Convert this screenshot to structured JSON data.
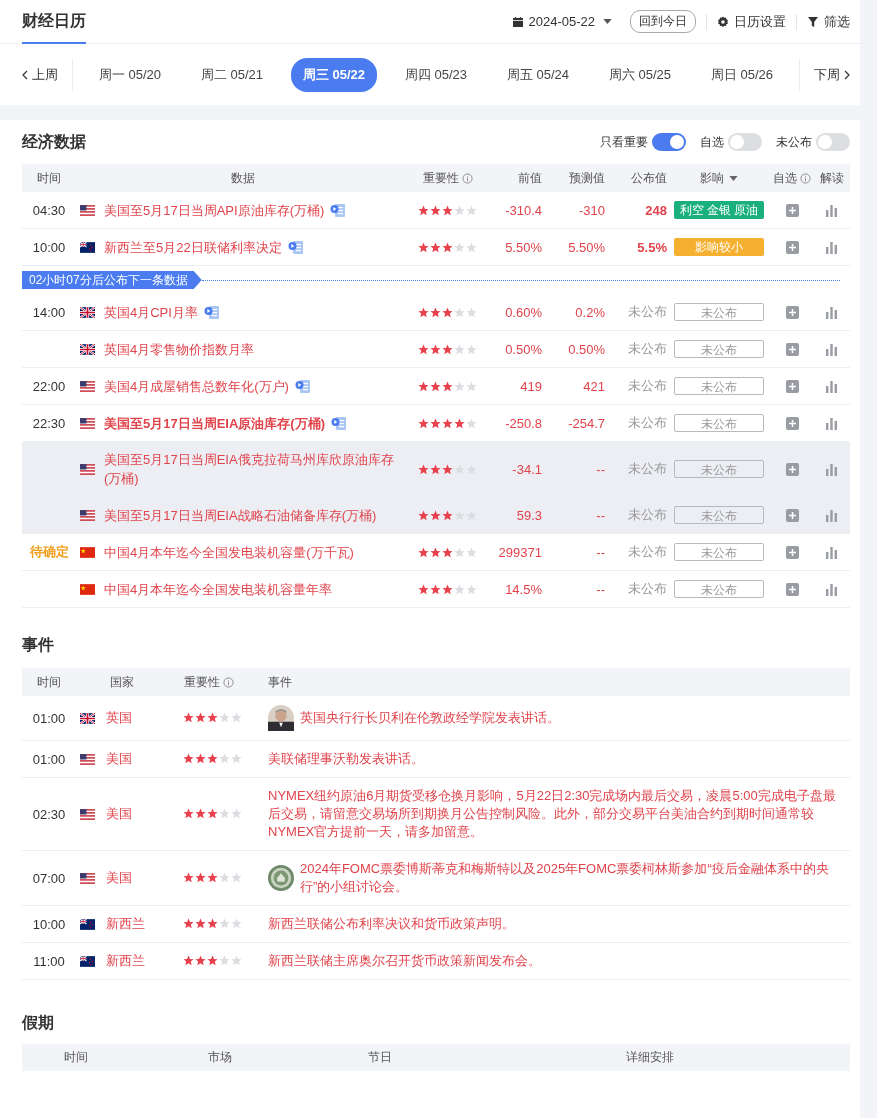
{
  "header": {
    "title": "财经日历",
    "date": "2024-05-22",
    "today_button": "回到今日",
    "settings": "日历设置",
    "filter": "筛选"
  },
  "week_nav": {
    "prev": "上周",
    "next": "下周",
    "days": [
      {
        "label": "周一 05/20",
        "selected": false
      },
      {
        "label": "周二 05/21",
        "selected": false
      },
      {
        "label": "周三 05/22",
        "selected": true
      },
      {
        "label": "周四 05/23",
        "selected": false
      },
      {
        "label": "周五 05/24",
        "selected": false
      },
      {
        "label": "周六 05/25",
        "selected": false
      },
      {
        "label": "周日 05/26",
        "selected": false
      }
    ]
  },
  "economic_data": {
    "title": "经济数据",
    "toggles": [
      {
        "label": "只看重要",
        "on": true
      },
      {
        "label": "自选",
        "on": false
      },
      {
        "label": "未公布",
        "on": false
      }
    ],
    "columns": [
      "时间",
      "数据",
      "重要性",
      "前值",
      "预测值",
      "公布值",
      "影响",
      "自选",
      "解读"
    ],
    "rows": [
      {
        "kind": "us",
        "time": "04:30",
        "tentative": false,
        "name": "美国至5月17日当周API原油库存(万桶)",
        "bold": false,
        "has_detail": true,
        "stars": 3,
        "previous": "-310.4",
        "forecast": "-310",
        "actual": "248",
        "released": true,
        "impact": {
          "kind": "bearish",
          "text": "利空 金银 原油"
        },
        "highlighted": false
      },
      {
        "kind": "nz",
        "time": "10:00",
        "tentative": false,
        "name": "新西兰至5月22日联储利率决定",
        "bold": false,
        "has_detail": true,
        "stars": 3,
        "previous": "5.50%",
        "forecast": "5.50%",
        "actual": "5.5%",
        "released": true,
        "impact": {
          "kind": "minor",
          "text": "影响较小"
        },
        "highlighted": false
      },
      {
        "kind": "countdown",
        "text": "02小时07分后公布下一条数据"
      },
      {
        "kind": "uk",
        "time": "14:00",
        "tentative": false,
        "name": "英国4月CPI月率",
        "bold": false,
        "has_detail": true,
        "stars": 3,
        "previous": "0.60%",
        "forecast": "0.2%",
        "actual": "未公布",
        "released": false,
        "impact": {
          "kind": "pending",
          "text": "未公布"
        },
        "highlighted": false
      },
      {
        "kind": "uk",
        "name": "英国4月零售物价指数月率",
        "bold": false,
        "has_detail": false,
        "stars": 3,
        "previous": "0.50%",
        "forecast": "0.50%",
        "actual": "未公布",
        "released": false,
        "impact": {
          "kind": "pending",
          "text": "未公布"
        },
        "highlighted": false
      },
      {
        "kind": "us",
        "time": "22:00",
        "tentative": false,
        "name": "美国4月成屋销售总数年化(万户)",
        "bold": false,
        "has_detail": true,
        "stars": 3,
        "previous": "419",
        "forecast": "421",
        "actual": "未公布",
        "released": false,
        "impact": {
          "kind": "pending",
          "text": "未公布"
        },
        "highlighted": false
      },
      {
        "kind": "us",
        "time": "22:30",
        "tentative": false,
        "name": "美国至5月17日当周EIA原油库存(万桶)",
        "bold": true,
        "has_detail": true,
        "stars": 4,
        "previous": "-250.8",
        "forecast": "-254.7",
        "actual": "未公布",
        "released": false,
        "impact": {
          "kind": "pending",
          "text": "未公布"
        },
        "highlighted": false
      },
      {
        "kind": "us",
        "name": "美国至5月17日当周EIA俄克拉荷马州库欣原油库存(万桶)",
        "bold": false,
        "has_detail": false,
        "stars": 3,
        "previous": "-34.1",
        "forecast": "--",
        "actual": "未公布",
        "released": false,
        "impact": {
          "kind": "pending",
          "text": "未公布"
        },
        "highlighted": true
      },
      {
        "kind": "us",
        "name": "美国至5月17日当周EIA战略石油储备库存(万桶)",
        "bold": false,
        "has_detail": false,
        "stars": 3,
        "previous": "59.3",
        "forecast": "--",
        "actual": "未公布",
        "released": false,
        "impact": {
          "kind": "pending",
          "text": "未公布"
        },
        "highlighted": true
      },
      {
        "kind": "cn",
        "time": "待确定",
        "tentative": true,
        "name": "中国4月本年迄今全国发电装机容量(万千瓦)",
        "bold": false,
        "has_detail": false,
        "stars": 3,
        "previous": "299371",
        "forecast": "--",
        "actual": "未公布",
        "released": false,
        "impact": {
          "kind": "pending",
          "text": "未公布"
        },
        "highlighted": false
      },
      {
        "kind": "cn",
        "name": "中国4月本年迄今全国发电装机容量年率",
        "bold": false,
        "has_detail": false,
        "stars": 3,
        "previous": "14.5%",
        "forecast": "--",
        "actual": "未公布",
        "released": false,
        "impact": {
          "kind": "pending",
          "text": "未公布"
        },
        "highlighted": false
      }
    ]
  },
  "events": {
    "title": "事件",
    "columns": [
      "时间",
      "国家",
      "重要性",
      "事件"
    ],
    "rows": [
      {
        "kind": "uk",
        "time": "01:00",
        "country": "英国",
        "stars": 3,
        "has_picture": true,
        "text": "英国央行行长贝利在伦敦政经学院发表讲话。"
      },
      {
        "kind": "us",
        "time": "01:00",
        "country": "美国",
        "stars": 3,
        "has_picture": false,
        "text": "美联储理事沃勒发表讲话。"
      },
      {
        "kind": "us",
        "time": "02:30",
        "country": "美国",
        "stars": 3,
        "has_picture": false,
        "text": "NYMEX纽约原油6月期货受移仓换月影响，5月22日2:30完成场内最后交易，凌晨5:00完成电子盘最后交易，请留意交易场所到期换月公告控制风险。此外，部分交易平台美油合约到期时间通常较NYMEX官方提前一天，请多加留意。"
      },
      {
        "kind": "us",
        "time": "07:00",
        "country": "美国",
        "stars": 3,
        "has_picture": true,
        "text": "2024年FOMC票委博斯蒂克和梅斯特以及2025年FOMC票委柯林斯参加“疫后金融体系中的央行”的小组讨论会。"
      },
      {
        "kind": "nz",
        "time": "10:00",
        "country": "新西兰",
        "stars": 3,
        "has_picture": false,
        "text": "新西兰联储公布利率决议和货币政策声明。"
      },
      {
        "kind": "nz",
        "time": "11:00",
        "country": "新西兰",
        "stars": 3,
        "has_picture": false,
        "text": "新西兰联储主席奥尔召开货币政策新闻发布会。"
      }
    ]
  },
  "holidays": {
    "title": "假期",
    "columns": [
      "时间",
      "市场",
      "节日",
      "详细安排"
    ]
  }
}
